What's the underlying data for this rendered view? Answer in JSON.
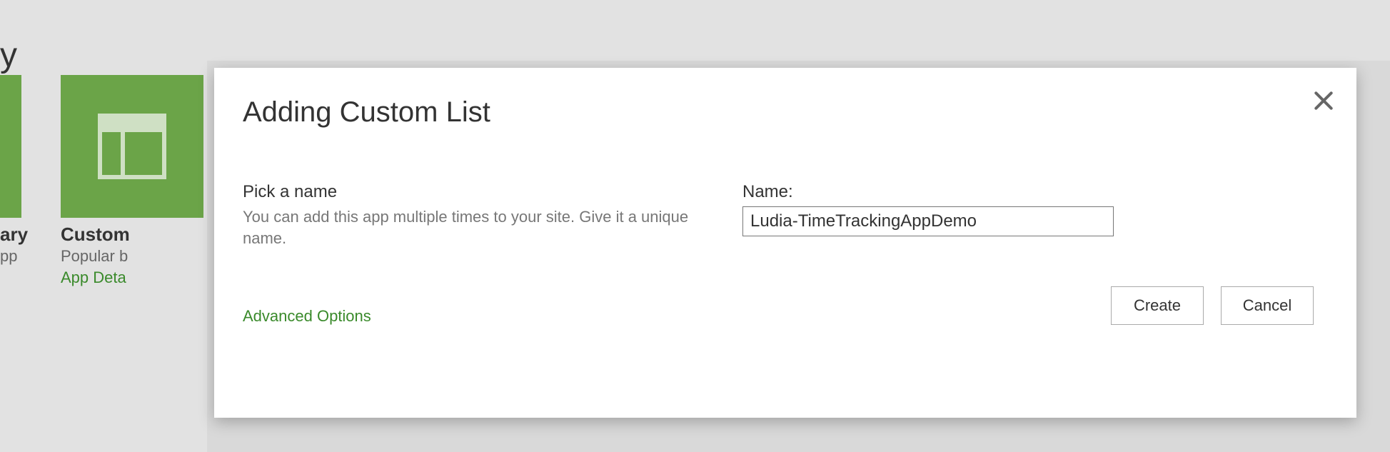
{
  "page": {
    "title_fragment": "y"
  },
  "tiles": [
    {
      "title_fragment": "ary",
      "subtitle_fragment": "pp"
    },
    {
      "title_fragment": "Custom ",
      "subtitle_fragment": "Popular b",
      "details_link_fragment": "App Deta"
    }
  ],
  "dialog": {
    "title": "Adding Custom List",
    "section_heading": "Pick a name",
    "section_desc": "You can add this app multiple times to your site. Give it a unique name.",
    "advanced_options": "Advanced Options",
    "name_label": "Name:",
    "name_value": "Ludia-TimeTrackingAppDemo",
    "create": "Create",
    "cancel": "Cancel"
  }
}
